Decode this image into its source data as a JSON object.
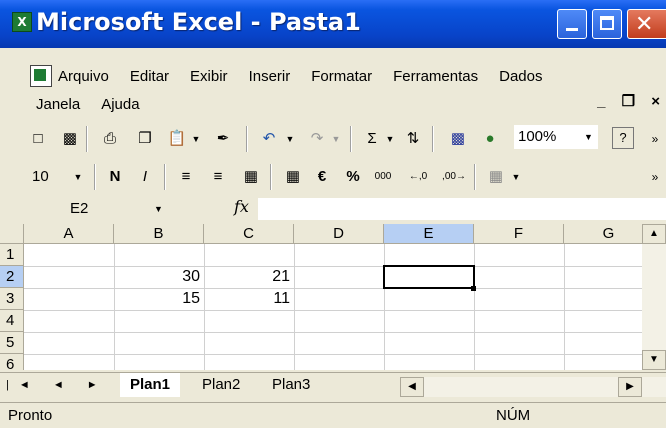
{
  "window": {
    "title": "Microsoft Excel - Pasta1",
    "app_icon": "excel-icon"
  },
  "menu": {
    "items": [
      "Arquivo",
      "Editar",
      "Exibir",
      "Inserir",
      "Formatar",
      "Ferramentas",
      "Dados"
    ],
    "row2": [
      "Janela",
      "Ajuda"
    ],
    "doc_controls": [
      "_",
      "❒",
      "×"
    ]
  },
  "toolbar": {
    "zoom": "100%",
    "help_icon": "?",
    "font_size": "10",
    "bold_label": "N",
    "italic_label": "I",
    "currency_symbol": "€",
    "percent_symbol": "%",
    "thousands_label": "000",
    "inc_decimal": "←,0",
    "dec_decimal": ",00→"
  },
  "formula_bar": {
    "cell_ref": "E2",
    "fx_label": "fx",
    "content": ""
  },
  "sheet": {
    "columns": [
      "A",
      "B",
      "C",
      "D",
      "E",
      "F",
      "G"
    ],
    "rows": [
      "1",
      "2",
      "3",
      "4",
      "5",
      "6"
    ],
    "selected_cell": "E2",
    "cells": {
      "B2": "30",
      "C2": "21",
      "B3": "15",
      "C3": "11"
    }
  },
  "tabs": {
    "nav": [
      "|◄",
      "◄",
      "►",
      "►|"
    ],
    "sheets": [
      "Plan1",
      "Plan2",
      "Plan3"
    ],
    "active": "Plan1"
  },
  "status": {
    "left": "Pronto",
    "num": "NÚM"
  }
}
